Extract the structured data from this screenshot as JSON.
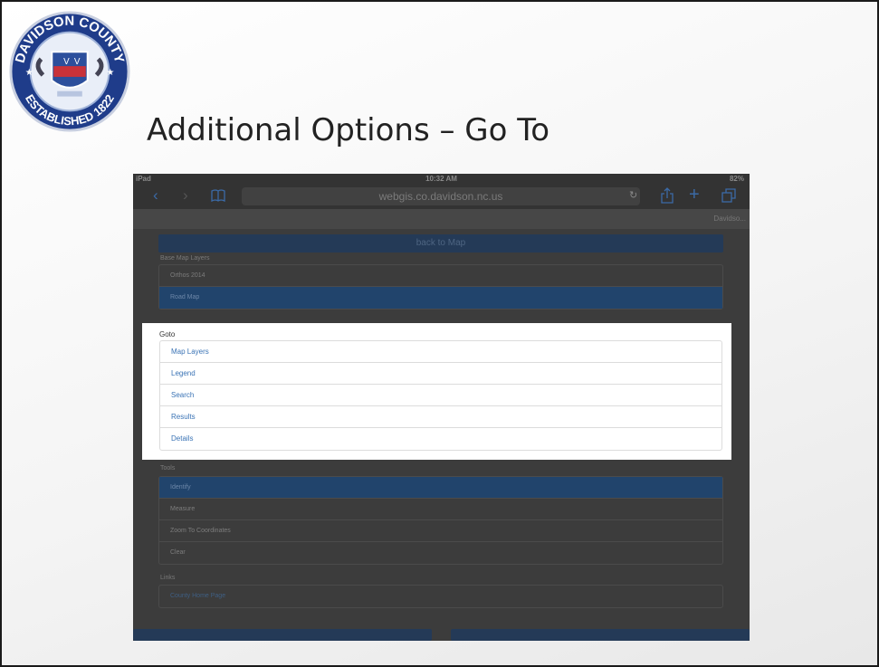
{
  "slide": {
    "title": "Additional Options – Go To",
    "seal_text": {
      "top": "DAVIDSON COUNTY",
      "bottom": "ESTABLISHED 1822"
    }
  },
  "ipad": {
    "status": {
      "left": "iPad",
      "time": "10:32 AM",
      "battery": "82%"
    },
    "url": "webgis.co.davidson.nc.us",
    "tab_label": "Davidso...",
    "back_button": "back to Map",
    "base_map": {
      "label": "Base Map Layers",
      "items": [
        {
          "label": "Orthos 2014"
        },
        {
          "label": "Road Map"
        }
      ]
    },
    "goto": {
      "label": "Goto",
      "items": [
        {
          "label": "Map Layers"
        },
        {
          "label": "Legend"
        },
        {
          "label": "Search"
        },
        {
          "label": "Results"
        },
        {
          "label": "Details"
        }
      ]
    },
    "tools": {
      "label": "Tools",
      "items": [
        {
          "label": "Identify"
        },
        {
          "label": "Measure"
        },
        {
          "label": "Zoom To Coordinates"
        },
        {
          "label": "Clear"
        }
      ]
    },
    "links": {
      "label": "Links",
      "items": [
        {
          "label": "County Home Page"
        }
      ]
    }
  },
  "icons": [
    "back-arrow-icon",
    "forward-arrow-icon",
    "bookmarks-icon",
    "reload-icon",
    "share-icon",
    "add-tab-icon",
    "tabs-icon",
    "county-seal-logo"
  ],
  "colors": {
    "accent": "#3a73b5",
    "active_row": "#21446c",
    "dim_overlay": "#3c3c3c"
  }
}
